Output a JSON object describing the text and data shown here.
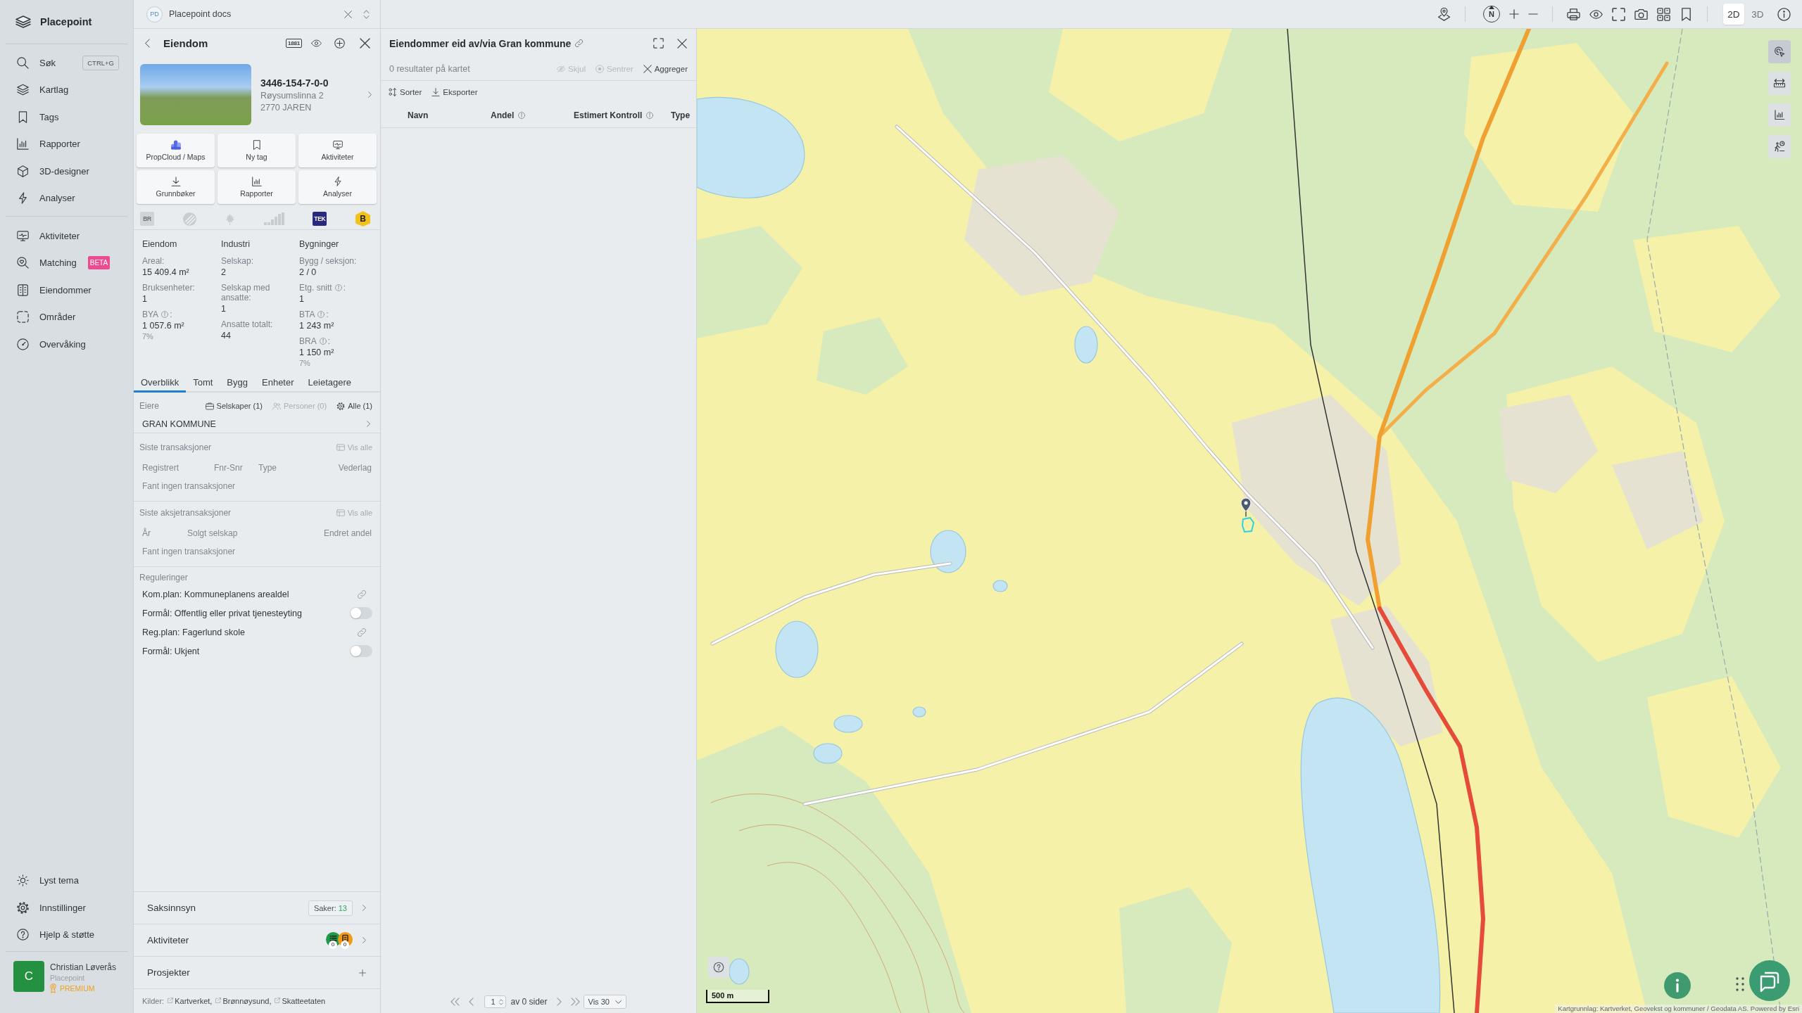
{
  "sidebar": {
    "title": "Placepoint",
    "main_items": [
      {
        "label": "Søk",
        "shortcut": "CTRL+G"
      },
      {
        "label": "Kartlag"
      },
      {
        "label": "Tags"
      },
      {
        "label": "Rapporter"
      },
      {
        "label": "3D-designer"
      },
      {
        "label": "Analyser"
      }
    ],
    "tool_items": [
      {
        "label": "Aktiviteter"
      },
      {
        "label": "Matching",
        "badge": "BETA"
      },
      {
        "label": "Eiendommer"
      },
      {
        "label": "Områder"
      },
      {
        "label": "Overvåking"
      }
    ],
    "footer_items": [
      {
        "label": "Lyst tema"
      },
      {
        "label": "Innstillinger"
      },
      {
        "label": "Hjelp & støtte"
      }
    ],
    "user": {
      "initial": "C",
      "name": "Christian Løverås",
      "organization": "Placepoint",
      "plan": "PREMIUM"
    }
  },
  "doc_tab": {
    "badge": "PD",
    "title": "Placepoint docs"
  },
  "property": {
    "title": "Eiendom",
    "lookup_badge": "1881",
    "id": "3446-154-7-0-0",
    "street": "Røysumslinna 2",
    "postal": "2770 JAREN",
    "actions": [
      {
        "label": "PropCloud / Maps"
      },
      {
        "label": "Ny tag"
      },
      {
        "label": "Aktiviteter"
      },
      {
        "label": "Grunnbøker"
      },
      {
        "label": "Rapporter"
      },
      {
        "label": "Analyser"
      }
    ],
    "certifications": [
      {
        "kind": "tile",
        "label": "BR",
        "enabled": false
      },
      {
        "kind": "swan",
        "enabled": false
      },
      {
        "kind": "leaf",
        "enabled": false
      },
      {
        "kind": "energy",
        "enabled": false
      },
      {
        "kind": "tile",
        "label": "TEK",
        "enabled": true
      },
      {
        "kind": "hexagon",
        "label": "B",
        "enabled": true
      }
    ],
    "stats": [
      {
        "heading": "Eiendom",
        "fields": [
          {
            "label": "Areal:",
            "info": false,
            "value": "15 409.4 m²"
          },
          {
            "label": "Bruksenheter:",
            "info": false,
            "value": "1"
          },
          {
            "label": "BYA",
            "info": true,
            "label_end": ":",
            "value": "1 057.6 m²",
            "note": "7%"
          }
        ]
      },
      {
        "heading": "Industri",
        "fields": [
          {
            "label": "Selskap:",
            "info": false,
            "value": "2"
          },
          {
            "label": "Selskap med ansatte:",
            "info": false,
            "value": "1"
          },
          {
            "label": "Ansatte totalt:",
            "info": false,
            "value": "44"
          }
        ]
      },
      {
        "heading": "Bygninger",
        "fields": [
          {
            "label": "Bygg / seksjon:",
            "info": false,
            "value": "2 / 0"
          },
          {
            "label": "Etg. snitt",
            "info": true,
            "label_end": ":",
            "value": "1"
          },
          {
            "label": "BTA",
            "info": true,
            "label_end": ":",
            "value": "1 243 m²"
          },
          {
            "label": "BRA",
            "info": true,
            "label_end": ":",
            "value": "1 150 m²",
            "note": "7%"
          }
        ]
      }
    ],
    "tabs": [
      {
        "label": "Overblikk",
        "selected": true
      },
      {
        "label": "Tomt",
        "selected": false
      },
      {
        "label": "Bygg",
        "selected": false
      },
      {
        "label": "Enheter",
        "selected": false
      },
      {
        "label": "Leietagere",
        "selected": false
      }
    ],
    "owners": {
      "label": "Eiere",
      "filters": [
        {
          "label": "Selskaper (1)",
          "enabled": true
        },
        {
          "label": "Personer (0)",
          "enabled": false
        },
        {
          "label": "Alle (1)",
          "enabled": true
        }
      ],
      "rows": [
        {
          "name": "GRAN KOMMUNE"
        }
      ]
    },
    "transactions": [
      {
        "title": "Siste transaksjoner",
        "action": "Vis alle",
        "columns": [
          "Registrert",
          "Fnr-Snr",
          "Type",
          "Vederlag"
        ],
        "empty": "Fant ingen transaksjoner"
      },
      {
        "title": "Siste aksjetransaksjoner",
        "action": "Vis alle",
        "columns": [
          "År",
          "Solgt selskap",
          "Endret andel"
        ],
        "empty": "Fant ingen transaksjoner"
      }
    ],
    "regulations": {
      "title": "Reguleringer",
      "rows": [
        {
          "kind": "link",
          "text": "Kom.plan: Kommuneplanens arealdel"
        },
        {
          "kind": "toggle",
          "text": "Formål: Offentlig eller privat tjenesteyting",
          "on": false
        },
        {
          "kind": "link",
          "text": "Reg.plan: Fagerlund skole"
        },
        {
          "kind": "toggle",
          "text": "Formål: Ukjent",
          "on": false
        }
      ]
    },
    "sections": [
      {
        "kind": "cases",
        "title": "Saksinnsyn",
        "tag_label": "Saker:",
        "tag_value": "13"
      },
      {
        "kind": "activities",
        "title": "Aktiviteter",
        "counters": [
          {
            "value": "0",
            "color": "#1e9a48"
          },
          {
            "value": "0",
            "color": "#f39a14"
          }
        ]
      },
      {
        "kind": "projects",
        "title": "Prosjekter"
      }
    ],
    "sources": {
      "label": "Kilder:",
      "items": [
        "Kartverket,",
        "Brønnøysund,",
        "Skatteetaten"
      ]
    }
  },
  "results": {
    "title": "Eiendommer eid av/via Gran kommune",
    "summary": "0 resultater på kartet",
    "actions": [
      {
        "label": "Skjul",
        "enabled": false
      },
      {
        "label": "Sentrer",
        "enabled": false
      },
      {
        "label": "Aggreger",
        "enabled": true
      }
    ],
    "tools": [
      {
        "label": "Sorter"
      },
      {
        "label": "Eksporter"
      }
    ],
    "columns": [
      {
        "label": "Navn",
        "info": false
      },
      {
        "label": "Andel",
        "info": true
      },
      {
        "label": "Estimert Kontroll",
        "info": true
      },
      {
        "label": "Type",
        "info": false
      }
    ],
    "pager": {
      "page": "1",
      "pages_text": "av 0 sider",
      "page_size": "Vis 30"
    }
  },
  "map": {
    "toolbar": {
      "north": "N",
      "view_modes": [
        {
          "label": "2D",
          "selected": true
        },
        {
          "label": "3D",
          "selected": false
        }
      ]
    },
    "side_tools": [
      {
        "selected": true
      },
      {
        "selected": false
      },
      {
        "selected": false
      },
      {
        "selected": false
      }
    ],
    "scale": "500 m",
    "attribution": "Kartgrunnlag: Kartverket, Geovekst og kommuner / Geodata AS. Powered by Esri"
  }
}
